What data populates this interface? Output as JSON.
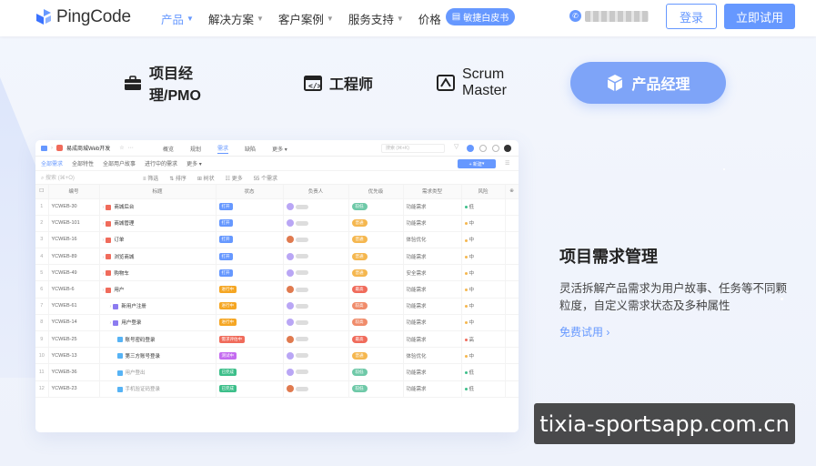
{
  "header": {
    "logo_text": "PingCode",
    "nav": [
      {
        "label": "产品",
        "active": true
      },
      {
        "label": "解决方案",
        "active": false
      },
      {
        "label": "客户案例",
        "active": false
      },
      {
        "label": "服务支持",
        "active": false
      },
      {
        "label": "价格",
        "active": false
      }
    ],
    "whitepaper_label": "敏捷白皮书",
    "login_label": "登录",
    "trial_label": "立即试用"
  },
  "roles": [
    {
      "label": "项目经理/PMO",
      "icon": "briefcase-icon"
    },
    {
      "label": "工程师",
      "icon": "code-terminal-icon"
    },
    {
      "label": "Scrum Master",
      "icon": "scrum-icon"
    },
    {
      "label": "产品经理",
      "icon": "cube-icon",
      "active": true
    }
  ],
  "app": {
    "project_name": "易成商城Web开发",
    "tabs": [
      "概览",
      "规划",
      "需求",
      "缺陷",
      "更多"
    ],
    "active_tab": "需求",
    "search_placeholder": "搜索 (⌘+K)",
    "views": [
      "全部需求",
      "全部特性",
      "全部用户故事",
      "进行中的需求",
      "更多"
    ],
    "new_label": "+ 新建",
    "toolbar": {
      "search": "搜索 (⌘+O)",
      "filter": "筛选",
      "sort": "排序",
      "tree": "树状",
      "more": "更多",
      "count": "55 个需求"
    },
    "columns": [
      "编号",
      "标题",
      "状态",
      "负责人",
      "优先级",
      "需求类型",
      "风险"
    ],
    "rows": [
      {
        "n": "1",
        "id": "YCWEB-30",
        "title": "商城后台",
        "status": "打开",
        "sc": "#6698ff",
        "pri": "较低",
        "pc": "#6fc9a8",
        "type": "功能需求",
        "risk": "低",
        "rc": "#3dbf8a",
        "indent": 0,
        "icon": "#f06b5b"
      },
      {
        "n": "2",
        "id": "YCWEB-101",
        "title": "商城管理",
        "status": "打开",
        "sc": "#6698ff",
        "pri": "普通",
        "pc": "#f5b74f",
        "type": "功能需求",
        "risk": "中",
        "rc": "#f5b74f",
        "indent": 0,
        "icon": "#f06b5b"
      },
      {
        "n": "3",
        "id": "YCWEB-16",
        "title": "订单",
        "status": "打开",
        "sc": "#6698ff",
        "pri": "普通",
        "pc": "#f5b74f",
        "type": "体验优化",
        "risk": "中",
        "rc": "#f5b74f",
        "indent": 0,
        "icon": "#f06b5b"
      },
      {
        "n": "4",
        "id": "YCWEB-89",
        "title": "浏览商城",
        "status": "打开",
        "sc": "#6698ff",
        "pri": "普通",
        "pc": "#f5b74f",
        "type": "功能需求",
        "risk": "中",
        "rc": "#f5b74f",
        "indent": 0,
        "icon": "#f06b5b"
      },
      {
        "n": "5",
        "id": "YCWEB-49",
        "title": "购物车",
        "status": "打开",
        "sc": "#6698ff",
        "pri": "普通",
        "pc": "#f5b74f",
        "type": "安全需求",
        "risk": "中",
        "rc": "#f5b74f",
        "indent": 0,
        "icon": "#f06b5b"
      },
      {
        "n": "6",
        "id": "YCWEB-6",
        "title": "用户",
        "status": "进行中",
        "sc": "#f5a623",
        "pri": "最高",
        "pc": "#f06b5b",
        "type": "功能需求",
        "risk": "中",
        "rc": "#f5b74f",
        "indent": 0,
        "icon": "#f06b5b"
      },
      {
        "n": "7",
        "id": "YCWEB-61",
        "title": "新用户注册",
        "status": "进行中",
        "sc": "#f5a623",
        "pri": "较高",
        "pc": "#f08c6b",
        "type": "功能需求",
        "risk": "中",
        "rc": "#f5b74f",
        "indent": 1,
        "icon": "#8c7bf0"
      },
      {
        "n": "8",
        "id": "YCWEB-14",
        "title": "用户登录",
        "status": "进行中",
        "sc": "#f5a623",
        "pri": "较高",
        "pc": "#f08c6b",
        "type": "功能需求",
        "risk": "中",
        "rc": "#f5b74f",
        "indent": 1,
        "icon": "#8c7bf0"
      },
      {
        "n": "9",
        "id": "YCWEB-25",
        "title": "账号密码登录",
        "status": "需求评估中",
        "sc": "#f06b5b",
        "pri": "最高",
        "pc": "#f06b5b",
        "type": "功能需求",
        "risk": "高",
        "rc": "#f06b5b",
        "indent": 2,
        "icon": "#56b3f5"
      },
      {
        "n": "10",
        "id": "YCWEB-13",
        "title": "第三方账号登录",
        "status": "测试中",
        "sc": "#c46bf0",
        "pri": "普通",
        "pc": "#f5b74f",
        "type": "体验优化",
        "risk": "中",
        "rc": "#f5b74f",
        "indent": 2,
        "icon": "#56b3f5"
      },
      {
        "n": "11",
        "id": "YCWEB-36",
        "title": "用户登出",
        "status": "已完成",
        "sc": "#3dbf8a",
        "pri": "较低",
        "pc": "#6fc9a8",
        "type": "功能需求",
        "risk": "低",
        "rc": "#3dbf8a",
        "indent": 2,
        "icon": "#56b3f5",
        "muted": true
      },
      {
        "n": "12",
        "id": "YCWEB-23",
        "title": "手机验证码登录",
        "status": "已完成",
        "sc": "#3dbf8a",
        "pri": "较低",
        "pc": "#6fc9a8",
        "type": "功能需求",
        "risk": "低",
        "rc": "#3dbf8a",
        "indent": 2,
        "icon": "#56b3f5",
        "muted": true
      }
    ]
  },
  "feature": {
    "title": "项目需求管理",
    "desc": "灵活拆解产品需求为用户故事、任务等不同颗粒度，自定义需求状态及多种属性",
    "link": "免费试用"
  },
  "watermark": "tixia-sportsapp.com.cn",
  "colors": {
    "accent": "#6698ff",
    "active_role": "#7ea4f8"
  }
}
